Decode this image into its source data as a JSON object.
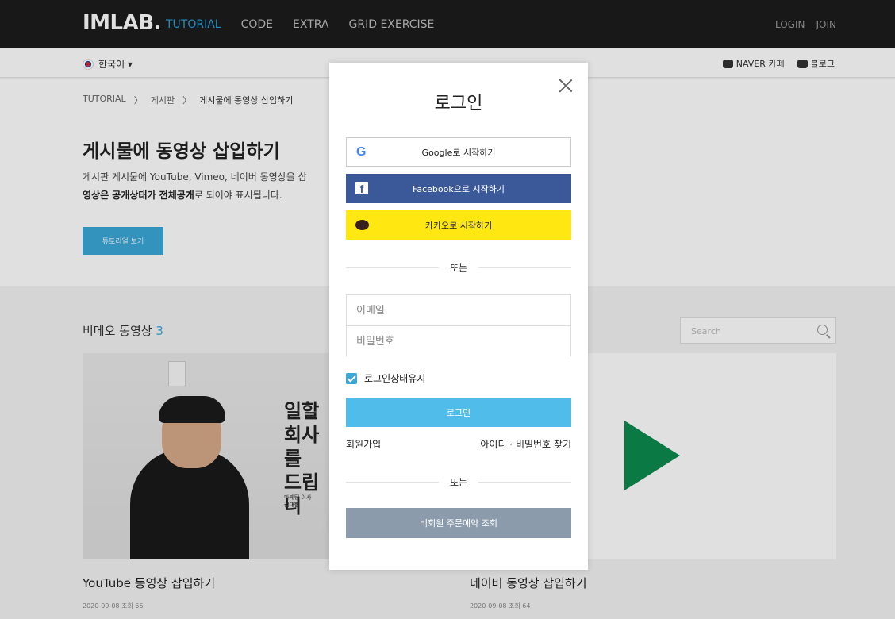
{
  "nav": {
    "logo": "IMLAB.",
    "menu": [
      "TUTORIAL",
      "CODE",
      "EXTRA",
      "GRID EXERCISE"
    ],
    "login": "LOGIN",
    "join": "JOIN",
    "accent": "#2a9fd8"
  },
  "subbar": {
    "language": "한국어 ▾",
    "naver_cafe": "NAVER 카페",
    "blog": "블로그"
  },
  "page": {
    "breadcrumb": [
      "TUTORIAL",
      "〉",
      "게시판",
      "〉",
      "게시물에 동영상 삽입하기"
    ],
    "title": "게시물에 동영상 삽입하기",
    "desc1": "게시판 게시물에 YouTube, Vimeo, 네이버 동영상을 삽",
    "desc2_bold": "영상은 공개상태가 전체공개",
    "desc2_rest": "로 되어야 표시됩니다.",
    "tutorial_button": "튜토리얼 보기"
  },
  "section": {
    "title": "비메오 동영상",
    "count": "3",
    "search_placeholder": "Search"
  },
  "cards": [
    {
      "thumb_text": [
        "일할",
        "회사를",
        "드립니"
      ],
      "thumb_caption": [
        "마케팅 이사",
        "김대현"
      ],
      "title": "YouTube 동영상 삽입하기",
      "meta": "2020-09-08  조회 66"
    },
    {
      "title": "네이버 동영상 삽입하기",
      "meta": "2020-09-08  조회 64"
    }
  ],
  "modal": {
    "title": "로그인",
    "google": "Google로 시작하기",
    "facebook": "Facebook으로 시작하기",
    "kakao": "카카오로 시작하기",
    "or": "또는",
    "email_placeholder": "이메일",
    "password_placeholder": "비밀번호",
    "keep_login": "로그인상태유지",
    "login_button": "로그인",
    "signup": "회원가입",
    "find_account": "아이디 · 비밀번호 찾기",
    "guest_order": "비회원 주문예약 조회",
    "colors": {
      "facebook": "#3b5998",
      "kakao": "#ffe812",
      "login": "#4fbce9",
      "guest": "#8b9bab"
    }
  }
}
